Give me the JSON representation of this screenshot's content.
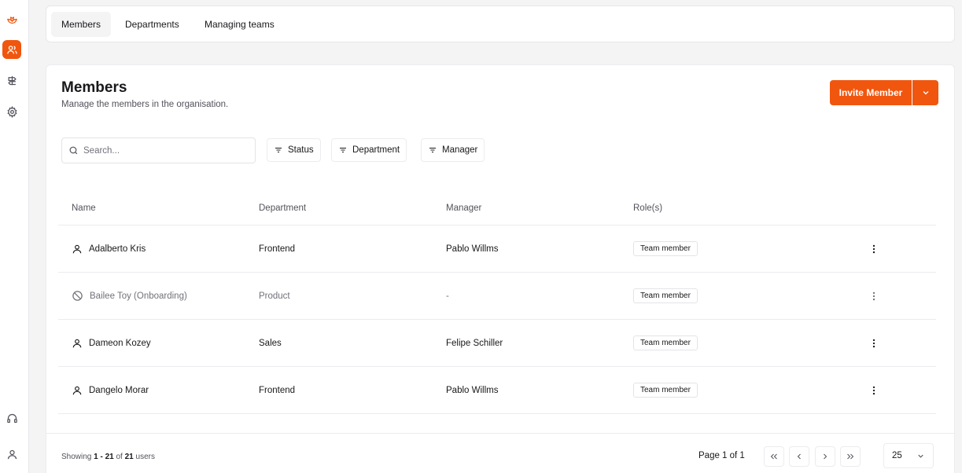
{
  "sidebar": {
    "items": [
      {
        "icon": "logo-icon"
      },
      {
        "icon": "users-icon",
        "active": true
      },
      {
        "icon": "signpost-icon"
      },
      {
        "icon": "gear-icon"
      },
      {
        "icon": "headset-icon"
      },
      {
        "icon": "user-profile-icon"
      }
    ]
  },
  "tabs": [
    {
      "label": "Members",
      "active": true
    },
    {
      "label": "Departments"
    },
    {
      "label": "Managing teams"
    }
  ],
  "header": {
    "title": "Members",
    "subtitle": "Manage the members in the organisation.",
    "invite_label": "Invite Member"
  },
  "search": {
    "placeholder": "Search..."
  },
  "filters": [
    "Status",
    "Department",
    "Manager"
  ],
  "table": {
    "columns": [
      "Name",
      "Department",
      "Manager",
      "Role(s)"
    ],
    "rows": [
      {
        "name": "Adalberto Kris",
        "department": "Frontend",
        "manager": "Pablo Willms",
        "role": "Team member",
        "status": "active"
      },
      {
        "name": "Bailee Toy (Onboarding)",
        "department": "Product",
        "manager": "-",
        "role": "Team member",
        "status": "onboarding"
      },
      {
        "name": "Dameon Kozey",
        "department": "Sales",
        "manager": "Felipe Schiller",
        "role": "Team member",
        "status": "active"
      },
      {
        "name": "Dangelo Morar",
        "department": "Frontend",
        "manager": "Pablo Willms",
        "role": "Team member",
        "status": "active"
      }
    ]
  },
  "footer": {
    "showing_prefix": "Showing ",
    "range": "1 - 21",
    "of": " of ",
    "total": "21",
    "suffix": " users",
    "page_info": "Page 1 of 1",
    "per_page": "25"
  },
  "colors": {
    "accent": "#f0560e"
  }
}
